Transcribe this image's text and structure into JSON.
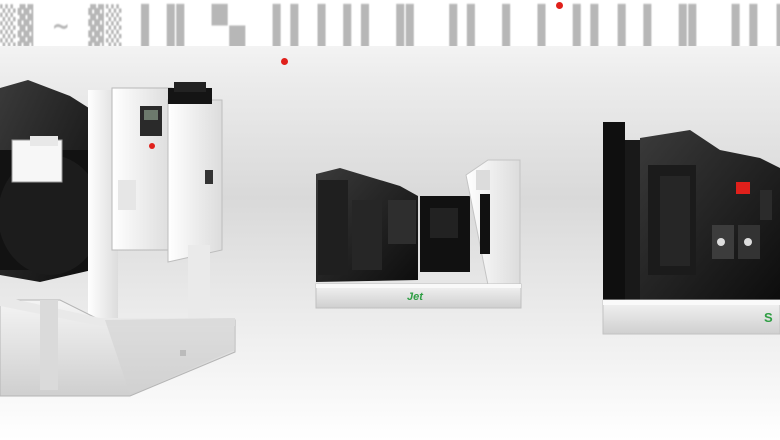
{
  "banner": {
    "scrambled_text": "▒▓ ~ ▓▒ ▌▐▌ ▀▄ ▐▐ ▌▐▐ ▐▌ ▐▐  ▐ ▐ ▐▐ ▌▐ ▐▌ ▐▐ ▌▐ ▐▐▌",
    "accent_dot_color": "#e0201b"
  },
  "products": [
    {
      "name": "generator-large-open"
    },
    {
      "name": "generator-small-open",
      "brand_label": "Jet"
    },
    {
      "name": "generator-medium-open",
      "brand_label": "S"
    }
  ],
  "colors": {
    "frame_white": "#f2f2f2",
    "engine_dark": "#1a1a1a",
    "brand_green": "#2f9e44",
    "accent_red": "#e0201b"
  }
}
